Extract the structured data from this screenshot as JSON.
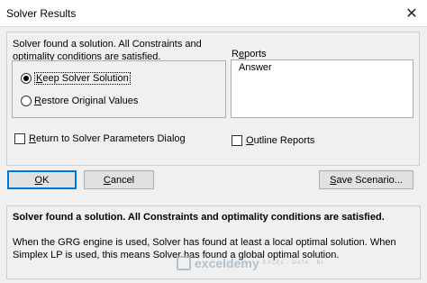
{
  "window": {
    "title": "Solver Results",
    "close_glyph": "✕"
  },
  "message": "Solver found a solution.  All Constraints and optimality conditions are satisfied.",
  "options": [
    {
      "prefix": "",
      "underline": "K",
      "rest": "eep Solver Solution",
      "selected": true
    },
    {
      "prefix": "",
      "underline": "R",
      "rest": "estore Original Values",
      "selected": false
    }
  ],
  "reports": {
    "label_prefix": "R",
    "label_underline": "e",
    "label_rest": "ports",
    "items": [
      "Answer"
    ]
  },
  "return_checkbox": {
    "prefix": "",
    "underline": "R",
    "rest": "eturn to Solver Parameters Dialog",
    "checked": false
  },
  "outline_checkbox": {
    "prefix": "",
    "underline": "O",
    "rest": "utline Reports",
    "checked": false
  },
  "buttons": {
    "ok": {
      "prefix": "",
      "underline": "O",
      "rest": "K"
    },
    "cancel": {
      "prefix": "",
      "underline": "C",
      "rest": "ancel"
    },
    "save": {
      "prefix": "",
      "underline": "S",
      "rest": "ave Scenario..."
    }
  },
  "description": {
    "title": "Solver found a solution.  All Constraints and optimality conditions are satisfied.",
    "body": "When the GRG engine is used, Solver has found at least a local optimal solution. When Simplex LP is used, this means Solver has found a global optimal solution."
  },
  "watermark": {
    "name": "exceldemy",
    "tagline": "EXCEL · DATA · BI"
  }
}
